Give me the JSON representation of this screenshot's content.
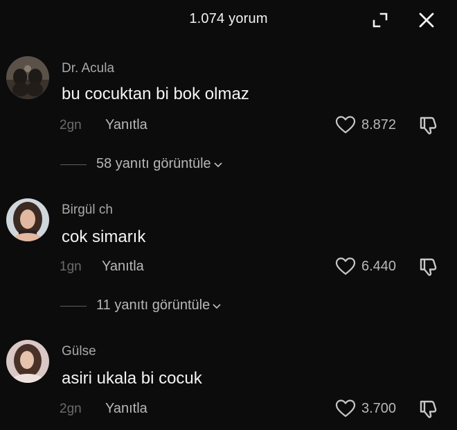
{
  "header": {
    "title": "1.074 yorum",
    "expand_icon": "expand-icon",
    "close_icon": "close-icon"
  },
  "comments": [
    {
      "username": "Dr. Acula",
      "text": "bu cocuktan bi bok olmaz",
      "time": "2gn",
      "reply_label": "Yanıtla",
      "likes": "8.872",
      "view_replies": "58 yanıtı görüntüle"
    },
    {
      "username": "Birgül ch",
      "text": "cok simarık",
      "time": "1gn",
      "reply_label": "Yanıtla",
      "likes": "6.440",
      "view_replies": "11 yanıtı görüntüle"
    },
    {
      "username": "Gülse",
      "text": "asiri ukala bi cocuk",
      "time": "2gn",
      "reply_label": "Yanıtla",
      "likes": "3.700"
    }
  ],
  "colors": {
    "background": "#0c0c0d",
    "primary_text": "#f4f4f4",
    "secondary_text": "#a9a9ab",
    "muted_text": "#6c6c6e"
  }
}
